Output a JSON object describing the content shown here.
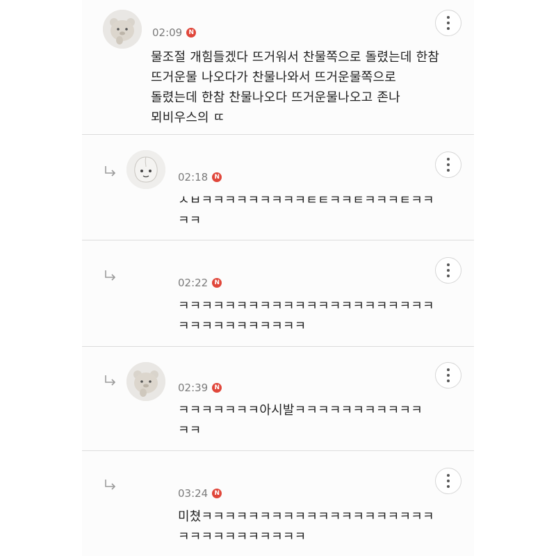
{
  "comments": [
    {
      "time": "02:09",
      "badge": "N",
      "text": "물조절 개힘들겠다 뜨거워서 찬물쪽으로 돌렸는데 한참\n뜨거운물 나오다가 찬물나와서 뜨거운물쪽으로\n돌렸는데 한참 찬물나오다 뜨거운물나오고 존나\n뫼비우스의 ㄸ",
      "avatar": "bear-avatar-icon"
    },
    {
      "time": "02:18",
      "badge": "N",
      "text": "ㅅㅂㅋㅋㅋㅋㅋㅋㅋㅋㅋㅌㅌㅋㅋㅌㅋㅋㅋㅌㅋㅋ\nㅋㅋ",
      "avatar": "peach-avatar-icon"
    },
    {
      "time": "02:22",
      "badge": "N",
      "text": "ㅋㅋㅋㅋㅋㅋㅋㅋㅋㅋㅋㅋㅋㅋㅋㅋㅋㅋㅋㅋㅋㅋ\nㅋㅋㅋㅋㅋㅋㅋㅋㅋㅋㅋ"
    },
    {
      "time": "02:39",
      "badge": "N",
      "text": "ㅋㅋㅋㅋㅋㅋㅋ아시발ㅋㅋㅋㅋㅋㅋㅋㅋㅋㅋㅋ\nㅋㅋ",
      "avatar": "bear-avatar-icon"
    },
    {
      "time": "03:24",
      "badge": "N",
      "text": "미쳤ㅋㅋㅋㅋㅋㅋㅋㅋㅋㅋㅋㅋㅋㅋㅋㅋㅋㅋㅋㅋ\nㅋㅋㅋㅋㅋㅋㅋㅋㅋㅋㅋ"
    }
  ],
  "icons": {
    "more": "more-vertical-icon",
    "reply": "reply-arrow-icon"
  },
  "colors": {
    "badge": "#e0463a",
    "time": "#7a7a7a"
  }
}
